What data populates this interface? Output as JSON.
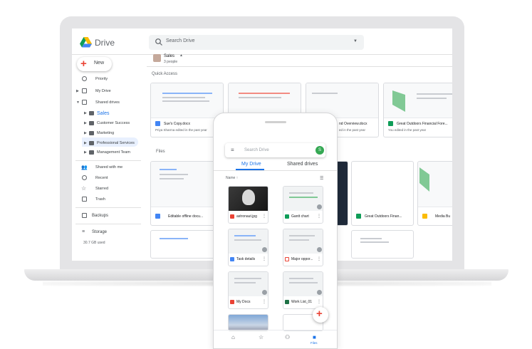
{
  "app": {
    "name": "Drive"
  },
  "search": {
    "placeholder": "Search Drive"
  },
  "new_button": {
    "label": "New"
  },
  "breadcrumb": {
    "title": "Sales",
    "subtitle": "3 people"
  },
  "sidebar": {
    "items": [
      {
        "label": "Priority",
        "icon": "checkbox-icon"
      },
      {
        "label": "My Drive",
        "icon": "my-drive-icon"
      },
      {
        "label": "Shared drives",
        "icon": "shared-drives-icon"
      },
      {
        "label": "Sales",
        "icon": "drive-icon"
      },
      {
        "label": "Customer Success",
        "icon": "drive-icon"
      },
      {
        "label": "Marketing",
        "icon": "drive-icon"
      },
      {
        "label": "Professional Services",
        "icon": "drive-icon"
      },
      {
        "label": "Management Team",
        "icon": "drive-icon"
      },
      {
        "label": "Shared with me",
        "icon": "people-icon"
      },
      {
        "label": "Recent",
        "icon": "clock-icon"
      },
      {
        "label": "Starred",
        "icon": "star-icon"
      },
      {
        "label": "Trash",
        "icon": "trash-icon"
      },
      {
        "label": "Backups",
        "icon": "backup-icon"
      },
      {
        "label": "Storage",
        "icon": "storage-icon"
      }
    ],
    "storage_used": "30.7 GB used"
  },
  "quick_access": {
    "label": "Quick Access",
    "cards": [
      {
        "title": "Sue's Copy.docx",
        "subtitle": "Priya Sharma edited in the past year",
        "type": "doc"
      },
      {
        "title": "",
        "subtitle": "",
        "type": "doc"
      },
      {
        "title": "nd Overview.docx",
        "subtitle": "ed in the past year",
        "type": "doc"
      },
      {
        "title": "Great Outdoors Financial Fore...",
        "subtitle": "You edited in the past year",
        "type": "sheet"
      }
    ]
  },
  "files": {
    "label": "Files",
    "cards": [
      {
        "title": "Editable offline docu...",
        "type": "doc"
      },
      {
        "title": "Great Outdoors Finan...",
        "type": "sheet"
      },
      {
        "title": "Media Bu",
        "type": "slides"
      }
    ]
  },
  "phone": {
    "search_placeholder": "Search Drive",
    "avatar": "S",
    "tabs": [
      "My Drive",
      "Shared drives"
    ],
    "sort_label": "Name ↑",
    "files": [
      {
        "name": "astronaut.jpg",
        "type": "image"
      },
      {
        "name": "Gantt chart",
        "type": "sheet"
      },
      {
        "name": "Task details",
        "type": "doc"
      },
      {
        "name": "Major oppor...",
        "type": "pdf"
      },
      {
        "name": "My Docs",
        "type": "slides"
      },
      {
        "name": "Work List_01",
        "type": "excel"
      }
    ],
    "bottom_nav": [
      "home-icon",
      "star-icon",
      "people-icon",
      "Files"
    ]
  },
  "colors": {
    "blue": "#1a73e8",
    "green": "#34a853",
    "red": "#ea4335",
    "yellow": "#fbbc04"
  }
}
